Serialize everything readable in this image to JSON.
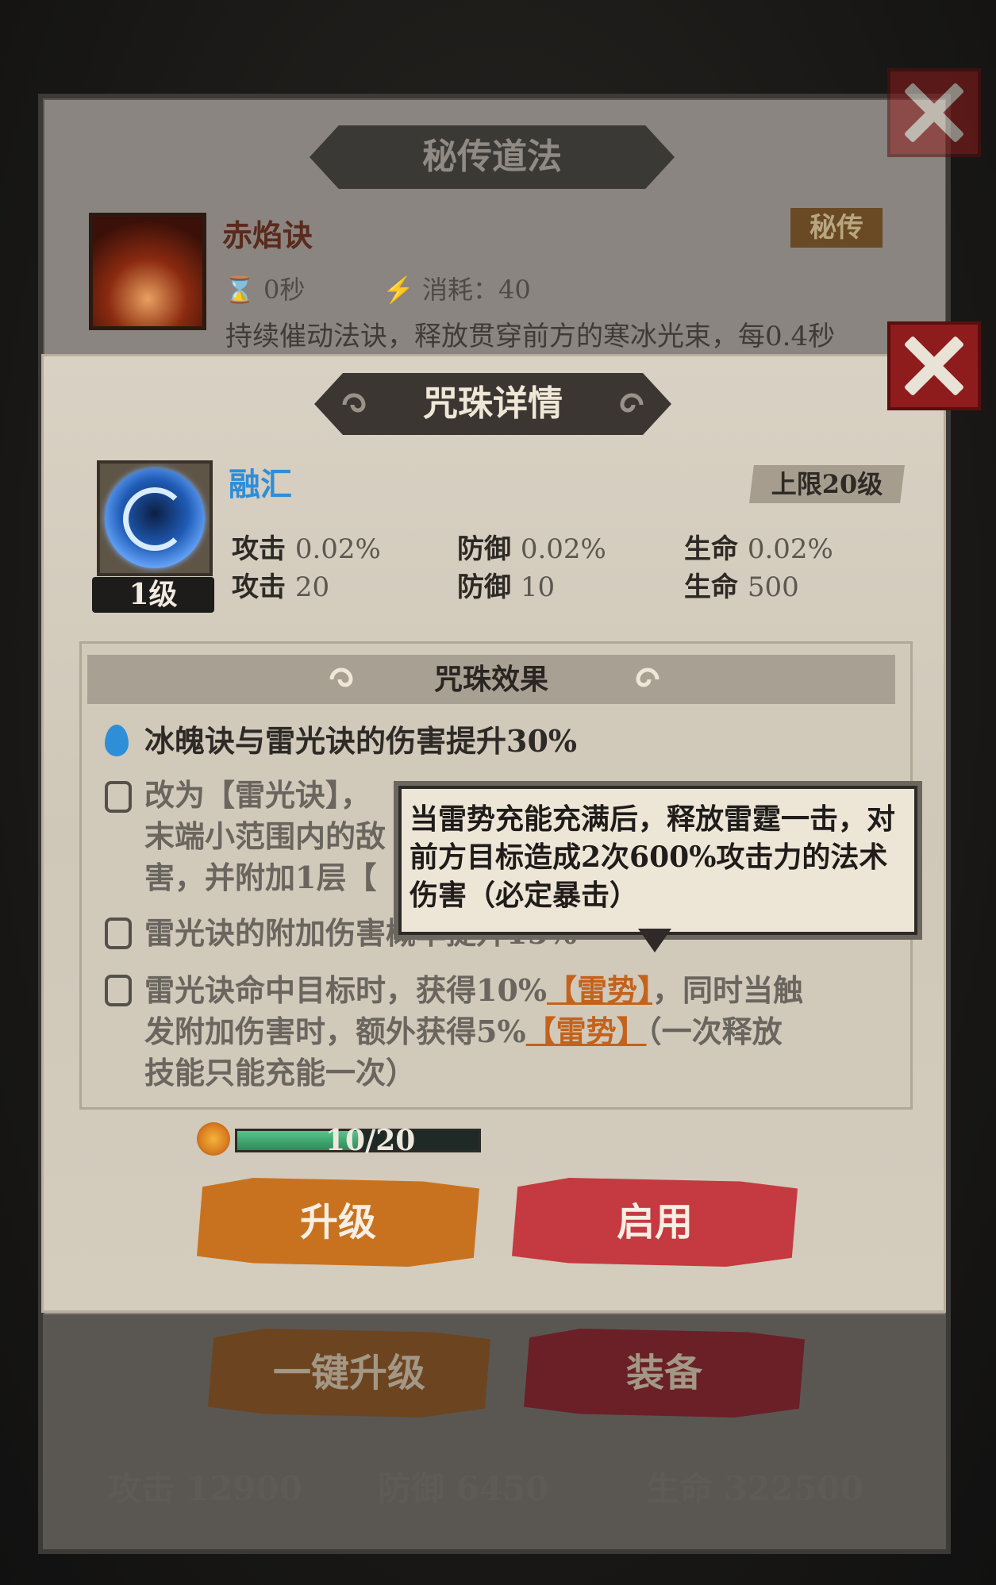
{
  "back_panel": {
    "title": "秘传道法",
    "skill_name": "赤焰诀",
    "badge": "秘传",
    "cooldown": "0秒",
    "cost": "消耗：40",
    "description": "持续催动法诀，释放贯穿前方的寒冰光束，每0.4秒"
  },
  "detail": {
    "title": "咒珠详情",
    "bead_name": "融汇",
    "level_cap": "上限20级",
    "level": "1级",
    "stats_percent": [
      {
        "label": "攻击",
        "value": "0.02%"
      },
      {
        "label": "防御",
        "value": "0.02%"
      },
      {
        "label": "生命",
        "value": "0.02%"
      }
    ],
    "stats_flat": [
      {
        "label": "攻击",
        "value": "20"
      },
      {
        "label": "防御",
        "value": "10"
      },
      {
        "label": "生命",
        "value": "500"
      }
    ]
  },
  "effects": {
    "title": "咒珠效果",
    "effect1": "冰魄诀与雷光诀的伤害提升30%",
    "effect2_line1": "改为【雷光诀】，",
    "effect2_line2": "末端小范围内的敌",
    "effect2_line3": "害，并附加1层【",
    "effect3": "雷光诀的附加伤害概率提升15%",
    "effect4_a": "雷光诀命中目标时，获得10%",
    "effect4_tag": "【雷势】",
    "effect4_b": "，同时当触",
    "effect4_c": "发附加伤害时，额外获得5%",
    "effect4_tag2": "【雷势】",
    "effect4_d": "（一次释放",
    "effect4_e": "技能只能充能一次）"
  },
  "tooltip": {
    "line1": "当雷势充能充满后，释放雷霆一击，对",
    "line2": "前方目标造成2次600%攻击力的法术",
    "line3": "伤害（必定暴击）"
  },
  "progress": {
    "text": "10/20",
    "fraction": 0.5
  },
  "buttons": {
    "upgrade": "升级",
    "enable": "启用",
    "upgrade_all": "一键升级",
    "equip": "装备"
  },
  "bottom_stats": {
    "attack": "攻击 12900",
    "defense": "防御 6450",
    "life": "生命 322500"
  },
  "colors": {
    "bead_name": "#2f8ed8",
    "tag": "#c4621c",
    "upgrade_button": "#c8721f",
    "enable_button": "#c43a40",
    "close_button": "#8e1c1c"
  },
  "icons": [
    "hourglass-icon",
    "lightning-icon",
    "close-icon",
    "water-drop-icon",
    "lock-icon",
    "swirl-icon",
    "bead-icon"
  ]
}
